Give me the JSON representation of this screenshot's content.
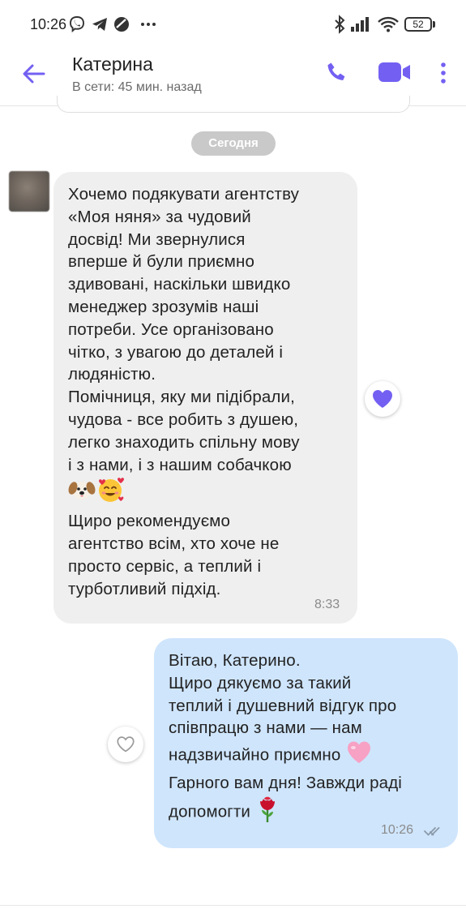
{
  "status_bar": {
    "time": "10:26",
    "battery": "52"
  },
  "header": {
    "contact_name": "Катерина",
    "contact_status": "В сети: 45 мин. назад"
  },
  "date_separator": "Сегодня",
  "messages": [
    {
      "direction": "incoming",
      "text_parts": [
        "Хочемо подякувати агентству\n«Моя няня» за чудовий\nдосвід! Ми звернулися\nвперше й були приємно\nздивовані, наскільки швидко\nменеджер зрозумів наші\nпотреби. Усе організовано\nчітко, з увагою до деталей і\nлюдяністю.\nПомічниця, яку ми підібрали,\nчудова - все робить з душею,\nлегко знаходить спільну мову\nі з нами, і з нашим собачкою\n",
        "\nЩиро рекомендуємо\nагентство всім, хто хоче не\nпросто сервіс, а теплий і\nтурботливий підхід."
      ],
      "emojis": [
        "dog-face",
        "smiling-face-with-hearts"
      ],
      "time": "8:33",
      "reaction": "purple-heart"
    },
    {
      "direction": "outgoing",
      "text_parts": [
        "Вітаю, Катерино.\nЩиро дякуємо за такий\nтеплий і душевний відгук про\nспівпрацю з нами — нам\nнадзвичайно приємно ",
        "\nГарного вам дня! Завжди раді\nдопомогти "
      ],
      "emojis": [
        "pink-heart",
        "rose"
      ],
      "time": "10:26",
      "delivery_status": "read-double-check",
      "reaction": "none"
    }
  ],
  "colors": {
    "accent": "#7360f2",
    "incoming_bubble": "#efefef",
    "outgoing_bubble": "#cfe5fc",
    "date_pill": "#c9c9c9"
  }
}
